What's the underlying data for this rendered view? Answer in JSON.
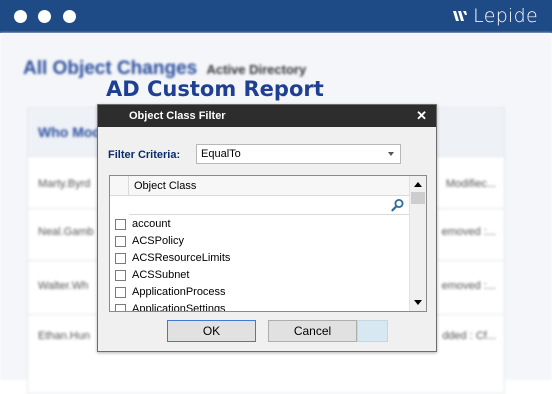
{
  "brand": {
    "name": "Lepide",
    "mark_icon": "lepide-logo-icon"
  },
  "window_controls": [
    "dot",
    "dot",
    "dot"
  ],
  "background": {
    "title": "All Object Changes",
    "subtitle": "Active Directory",
    "column_header": "Who Mod",
    "rows": [
      {
        "who": "Marty.Byrd",
        "right": "Modifiec..."
      },
      {
        "who": "Neal.Gamb",
        "right": "emoved :..."
      },
      {
        "who": "Walter.Wh",
        "right": "emoved :..."
      },
      {
        "who": "Ethan.Hun",
        "right": "dded : Cf..."
      }
    ]
  },
  "report_title": "AD Custom Report",
  "dialog": {
    "title": "Object Class Filter",
    "close_label": "✕",
    "filter_label": "Filter Criteria:",
    "filter_value": "EqualTo",
    "column_header": "Object Class",
    "items": [
      {
        "label": "account",
        "checked": false
      },
      {
        "label": "ACSPolicy",
        "checked": false
      },
      {
        "label": "ACSResourceLimits",
        "checked": false
      },
      {
        "label": "ACSSubnet",
        "checked": false
      },
      {
        "label": "ApplicationProcess",
        "checked": false
      },
      {
        "label": "ApplicationSettings",
        "checked": false
      }
    ],
    "ok_label": "OK",
    "cancel_label": "Cancel"
  },
  "colors": {
    "topbar": "#1e4a86",
    "title_blue": "#1f3f93",
    "dialog_titlebar": "#2d2d2d",
    "label_navy": "#0a2a6a"
  }
}
